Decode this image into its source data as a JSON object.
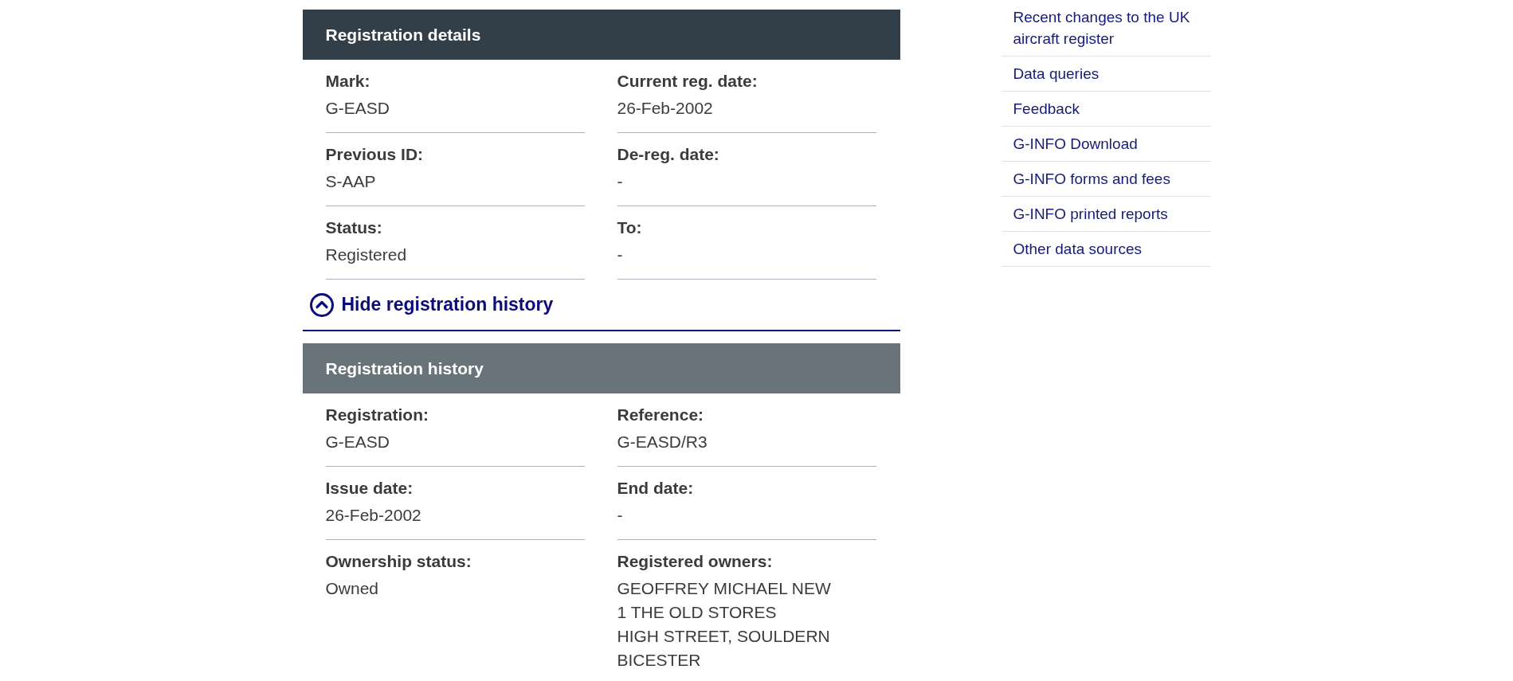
{
  "registration_details": {
    "title": "Registration details",
    "fields": [
      {
        "label": "Mark:",
        "value": "G-EASD"
      },
      {
        "label": "Current reg. date:",
        "value": "26-Feb-2002"
      },
      {
        "label": "Previous ID:",
        "value": "S-AAP"
      },
      {
        "label": "De-reg. date:",
        "value": "-"
      },
      {
        "label": "Status:",
        "value": "Registered"
      },
      {
        "label": "To:",
        "value": "-"
      }
    ]
  },
  "history_toggle": {
    "label": "Hide registration history",
    "expanded": true
  },
  "registration_history": {
    "title": "Registration history",
    "fields": [
      {
        "label": "Registration:",
        "value": "G-EASD"
      },
      {
        "label": "Reference:",
        "value": "G-EASD/R3"
      },
      {
        "label": "Issue date:",
        "value": "26-Feb-2002"
      },
      {
        "label": "End date:",
        "value": "-"
      },
      {
        "label": "Ownership status:",
        "value": "Owned"
      },
      {
        "label": "Registered owners:",
        "value": [
          "GEOFFREY MICHAEL NEW",
          "1 THE OLD STORES",
          "HIGH STREET, SOULDERN",
          "BICESTER"
        ]
      }
    ]
  },
  "sidebar": {
    "links": [
      "Recent changes to the UK aircraft register",
      "Data queries",
      "Feedback",
      "G-INFO Download",
      "G-INFO forms and fees",
      "G-INFO printed reports",
      "Other data sources"
    ]
  }
}
